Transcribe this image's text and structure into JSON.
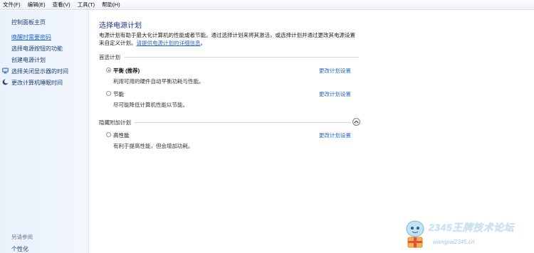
{
  "menubar": {
    "items": [
      "文件(F)",
      "编辑(E)",
      "查看(V)",
      "工具(T)",
      "帮助(H)"
    ]
  },
  "sidebar": {
    "home": "控制面板主页",
    "links": [
      {
        "label": "唤醒时需要密码",
        "active": true,
        "icon": ""
      },
      {
        "label": "选择电源按钮的功能",
        "active": false,
        "icon": ""
      },
      {
        "label": "创建电源计划",
        "active": false,
        "icon": ""
      },
      {
        "label": "选择关闭显示器的时间",
        "active": false,
        "icon": "monitor-icon"
      },
      {
        "label": "更改计算机睡眠时间",
        "active": false,
        "icon": "moon-icon"
      }
    ],
    "see_also": "另请参阅",
    "personalize": "个性化"
  },
  "main": {
    "title": "选择电源计划",
    "desc_line1": "电源计划有助于最大化计算机的性能或者节能。通过选择计划来将其激活，或选择计划并通过更改其电源设置",
    "desc_line2_prefix": "来自定义计划。",
    "desc_link": "请提供电源计划的详细信息",
    "desc_suffix": "。",
    "preferred_header": "首选计划",
    "hidden_header": "隐藏附加计划",
    "plans": [
      {
        "name": "平衡 (推荐)",
        "desc": "利用可用的硬件自动平衡功耗与性能。",
        "selected": true,
        "link": "更改计划设置"
      },
      {
        "name": "节能",
        "desc": "尽可能降低计算机性能以节能。",
        "selected": false,
        "link": "更改计划设置"
      },
      {
        "name": "高性能",
        "desc": "有利于提高性能，但会增加功耗。",
        "selected": false,
        "link": "更改计划设置"
      }
    ]
  },
  "watermark": {
    "text": "2345王牌技术论坛",
    "url": "wangpai2345.cn"
  }
}
